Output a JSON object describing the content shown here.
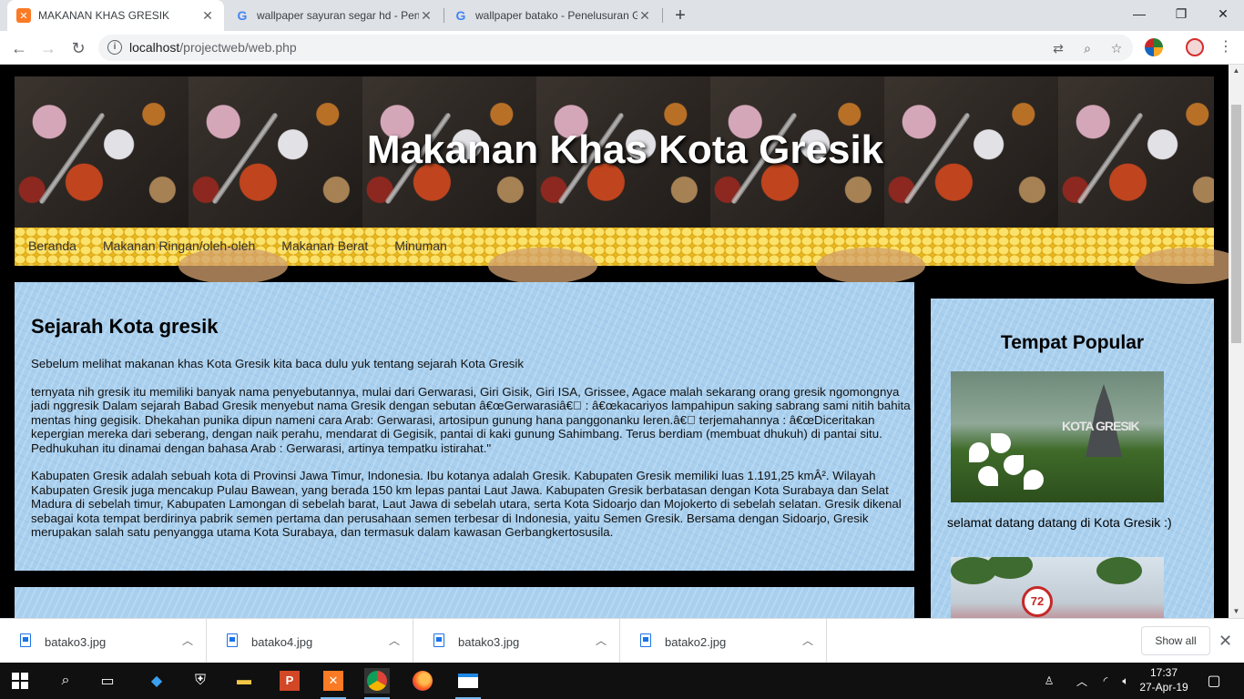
{
  "browser": {
    "tabs": [
      {
        "title": "MAKANAN KHAS GRESIK",
        "favicon": "xampp-icon",
        "active": true
      },
      {
        "title": "wallpaper sayuran segar hd - Pen",
        "favicon": "google-icon",
        "active": false
      },
      {
        "title": "wallpaper batako - Penelusuran G",
        "favicon": "google-icon",
        "active": false
      }
    ],
    "url_host": "localhost",
    "url_path": "/projectweb/web.php"
  },
  "page": {
    "header_title": "Makanan Khas Kota Gresik",
    "nav": [
      "Beranda",
      "Makanan Ringan/oleh-oleh",
      "Makanan Berat",
      "Minuman"
    ],
    "article": {
      "heading": "Sejarah Kota gresik",
      "intro": "Sebelum melihat makanan khas Kota Gresik kita baca dulu yuk tentang sejarah Kota Gresik",
      "para1": "ternyata nih gresik itu memiliki banyak nama penyebutannya, mulai dari Gerwarasi, Giri Gisik, Giri ISA, Grissee, Agace malah sekarang orang gresik ngomongnya jadi nggresik Dalam sejarah Babad Gresik menyebut nama Gresik dengan sebutan â€œGerwarasiâ€\u0000 : â€œkacariyos lampahipun saking sabrang sami nitih bahita mentas hing gegisik. Dhekahan punika dipun nameni cara Arab: Gerwarasi, artosipun gunung hana panggonanku leren.â€\u0000 terjemahannya : â€œDiceritakan kepergian mereka dari seberang, dengan naik perahu, mendarat di Gegisik, pantai di kaki gunung Sahimbang. Terus berdiam (membuat dhukuh) di pantai situ. Pedhukuhan itu dinamai dengan bahasa Arab : Gerwarasi, artinya tempatku istirahat.\"",
      "para2": "Kabupaten Gresik adalah sebuah kota di Provinsi Jawa Timur, Indonesia. Ibu kotanya adalah Gresik. Kabupaten Gresik memiliki luas 1.191,25 kmÂ². Wilayah Kabupaten Gresik juga mencakup Pulau Bawean, yang berada 150 km lepas pantai Laut Jawa. Kabupaten Gresik berbatasan dengan Kota Surabaya dan Selat Madura di sebelah timur, Kabupaten Lamongan di sebelah barat, Laut Jawa di sebelah utara, serta Kota Sidoarjo dan Mojokerto di sebelah selatan. Gresik dikenal sebagai kota tempat berdirinya pabrik semen pertama dan perusahaan semen terbesar di Indonesia, yaitu Semen Gresik. Bersama dengan Sidoarjo, Gresik merupakan salah satu penyangga utama Kota Surabaya, dan termasuk dalam kawasan Gerbangkertosusila."
    },
    "sidebar": {
      "heading": "Tempat Popular",
      "photo1_sign": "KOTA GRESIK",
      "caption": "selamat datang datang di Kota Gresik :)",
      "photo2_badge": "72"
    }
  },
  "downloads": {
    "items": [
      "batako3.jpg",
      "batako4.jpg",
      "batako3.jpg",
      "batako2.jpg"
    ],
    "show_all": "Show all"
  },
  "taskbar": {
    "time": "17:37",
    "date": "27-Apr-19"
  }
}
